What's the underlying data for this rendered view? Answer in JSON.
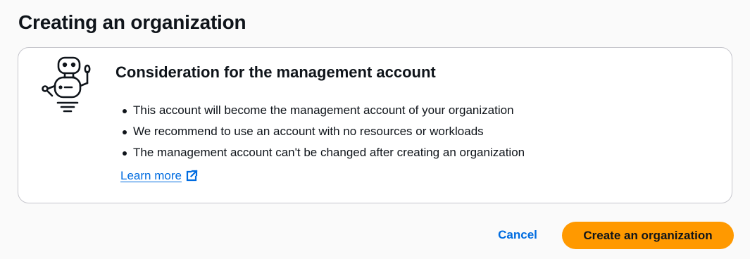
{
  "page": {
    "title": "Creating an organization"
  },
  "card": {
    "icon": "robot-icon",
    "title": "Consideration for the management account",
    "bullets": [
      "This account will become the management account of your organization",
      "We recommend to use an account with no resources or workloads",
      "The management account can't be changed after creating an organization"
    ],
    "learn_more": {
      "label": "Learn more",
      "icon": "external-link-icon"
    }
  },
  "actions": {
    "cancel_label": "Cancel",
    "create_label": "Create an organization"
  },
  "colors": {
    "link": "#006ce0",
    "primary_button": "#ff9900",
    "text": "#0f141a",
    "card_border": "#c6c6cd",
    "background": "#fafafa"
  }
}
